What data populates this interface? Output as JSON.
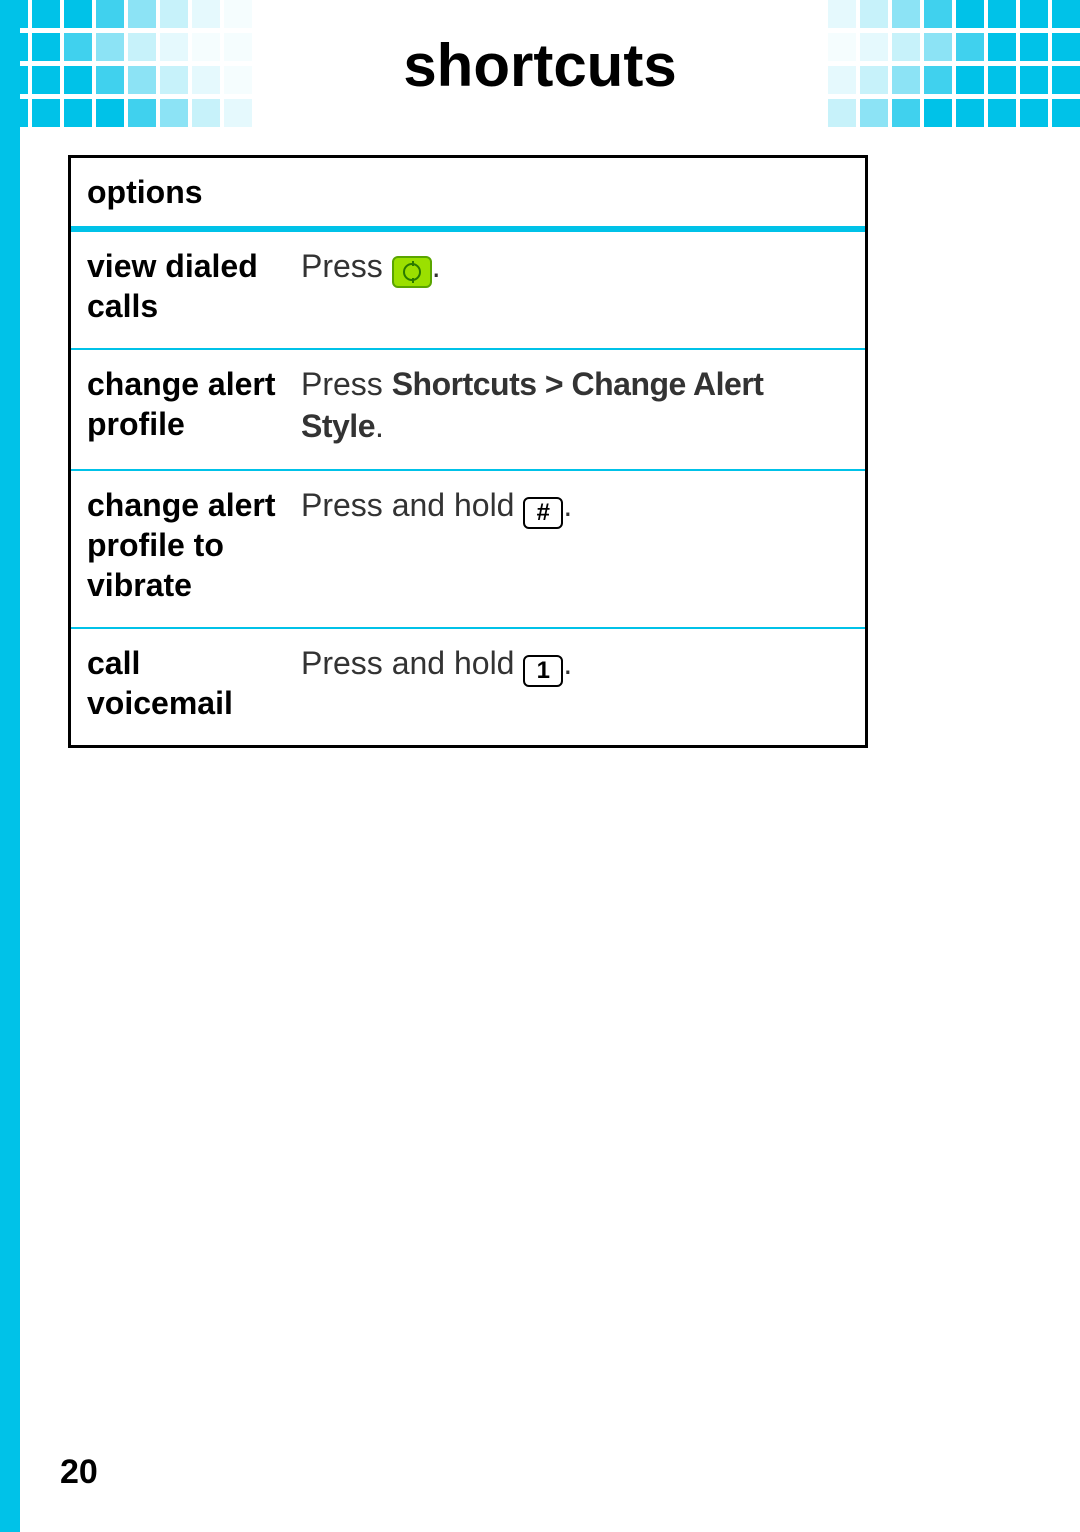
{
  "header": {
    "title": "shortcuts"
  },
  "table": {
    "header_label": "options",
    "rows": [
      {
        "label": "view dialed calls",
        "instr_pre": "Press ",
        "key_type": "green-dial",
        "key_glyph": "",
        "instr_post": "."
      },
      {
        "label": "change alert profile",
        "instr_pre": "Press ",
        "menu_path": "Shortcuts > Change Alert Style",
        "instr_post": "."
      },
      {
        "label": "change alert profile to vibrate",
        "instr_pre": "Press and hold ",
        "key_type": "plain",
        "key_glyph": "#",
        "instr_post": "."
      },
      {
        "label": "call voicemail",
        "instr_pre": "Press and hold ",
        "key_type": "plain",
        "key_glyph": "1",
        "instr_post": "."
      }
    ]
  },
  "page_number": "20"
}
